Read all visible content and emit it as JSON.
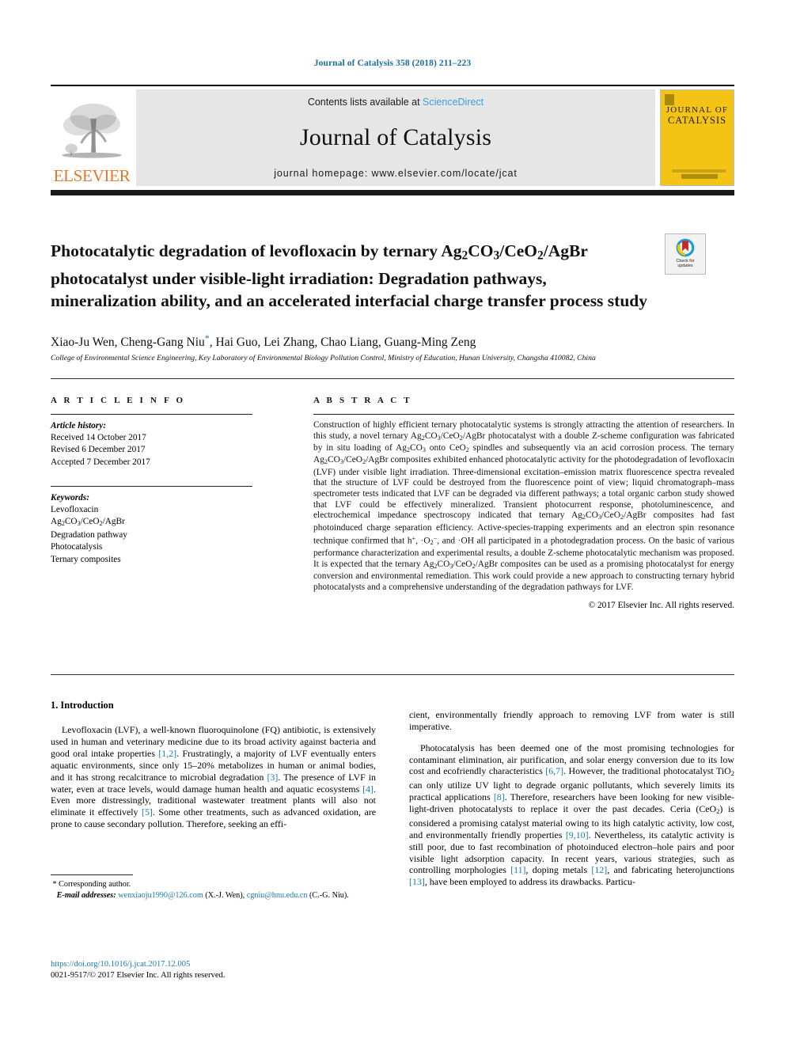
{
  "running_head": "Journal of Catalysis 358 (2018) 211–223",
  "masthead": {
    "publisher_logo_text": "ELSEVIER",
    "contents_line_prefix": "Contents lists available at ",
    "contents_line_link": "ScienceDirect",
    "journal_title": "Journal of Catalysis",
    "homepage_line": "journal homepage: www.elsevier.com/locate/jcat",
    "cover_line1": "JOURNAL OF",
    "cover_line2": "CATALYSIS"
  },
  "crossmark": {
    "line1": "Check for",
    "line2": "updates"
  },
  "article": {
    "title_part1": "Photocatalytic degradation of levofloxacin by ternary Ag",
    "title_sub1": "2",
    "title_part2": "CO",
    "title_sub2": "3",
    "title_part3": "/CeO",
    "title_sub3": "2",
    "title_part4": "/AgBr photocatalyst under visible-light irradiation: Degradation pathways, mineralization ability, and an accelerated interfacial charge transfer process study",
    "title_plain": "Photocatalytic degradation of levofloxacin by ternary Ag2CO3/CeO2/AgBr photocatalyst under visible-light irradiation: Degradation pathways, mineralization ability, and an accelerated interfacial charge transfer process study",
    "authors": "Xiao-Ju Wen, Cheng-Gang Niu",
    "authors_tail": ", Hai Guo, Lei Zhang, Chao Liang, Guang-Ming Zeng",
    "corresponding_marker": "*",
    "affiliation": "College of Environmental Science Engineering, Key Laboratory of Environmental Biology Pollution Control, Ministry of Education, Hunan University, Changsha 410082, China"
  },
  "info": {
    "heading": "A R T I C L E   I N F O",
    "history_label": "Article history:",
    "history": [
      "Received 14 October 2017",
      "Revised 6 December 2017",
      "Accepted 7 December 2017"
    ],
    "keywords_label": "Keywords:",
    "keywords": [
      "Levofloxacin",
      "Ag2CO3/CeO2/AgBr",
      "Degradation pathway",
      "Photocatalysis",
      "Ternary composites"
    ]
  },
  "abstract": {
    "heading": "A B S T R A C T",
    "text": "Construction of highly efficient ternary photocatalytic systems is strongly attracting the attention of researchers. In this study, a novel ternary Ag2CO3/CeO2/AgBr photocatalyst with a double Z-scheme configuration was fabricated by in situ loading of Ag2CO3 onto CeO2 spindles and subsequently via an acid corrosion process. The ternary Ag2CO3/CeO2/AgBr composites exhibited enhanced photocatalytic activity for the photodegradation of levofloxacin (LVF) under visible light irradiation. Three-dimensional excitation–emission matrix fluorescence spectra revealed that the structure of LVF could be destroyed from the fluorescence point of view; liquid chromatograph–mass spectrometer tests indicated that LVF can be degraded via different pathways; a total organic carbon study showed that LVF could be effectively mineralized. Transient photocurrent response, photoluminescence, and electrochemical impedance spectroscopy indicated that ternary Ag2CO3/CeO2/AgBr composites had fast photoinduced charge separation efficiency. Active-species-trapping experiments and an electron spin resonance technique confirmed that h+, ·O2−, and ·OH all participated in a photodegradation process. On the basic of various performance characterization and experimental results, a double Z-scheme photocatalytic mechanism was proposed. It is expected that the ternary Ag2CO3/CeO2/AgBr composites can be used as a promising photocatalyst for energy conversion and environmental remediation. This work could provide a new approach to constructing ternary hybrid photocatalysts and a comprehensive understanding of the degradation pathways for LVF.",
    "copyright": "© 2017 Elsevier Inc. All rights reserved."
  },
  "section": {
    "number_title": "1. Introduction",
    "left_paragraph": "Levofloxacin (LVF), a well-known fluoroquinolone (FQ) antibiotic, is extensively used in human and veterinary medicine due to its broad activity against bacteria and good oral intake properties [1,2]. Frustratingly, a majority of LVF eventually enters aquatic environments, since only 15–20% metabolizes in human or animal bodies, and it has strong recalcitrance to microbial degradation [3]. The presence of LVF in water, even at trace levels, would damage human health and aquatic ecosystems [4]. Even more distressingly, traditional wastewater treatment plants will also not eliminate it effectively [5]. Some other treatments, such as advanced oxidation, are prone to cause secondary pollution. Therefore, seeking an effi-",
    "right_paragraph_1": "cient, environmentally friendly approach to removing LVF from water is still imperative.",
    "right_paragraph_2": "Photocatalysis has been deemed one of the most promising technologies for contaminant elimination, air purification, and solar energy conversion due to its low cost and ecofriendly characteristics [6,7]. However, the traditional photocatalyst TiO2 can only utilize UV light to degrade organic pollutants, which severely limits its practical applications [8]. Therefore, researchers have been looking for new visible-light-driven photocatalysts to replace it over the past decades. Ceria (CeO2) is considered a promising catalyst material owing to its high catalytic activity, low cost, and environmentally friendly properties [9,10]. Nevertheless, its catalytic activity is still poor, due to fast recombination of photoinduced electron–hole pairs and poor visible light adsorption capacity. In recent years, various strategies, such as controlling morphologies [11], doping metals [12], and fabricating heterojunctions [13], have been employed to address its drawbacks. Particu-"
  },
  "footnote": {
    "corresponding": "Corresponding author.",
    "email_label": "E-mail addresses:",
    "email1": "wenxiaoju1990@126.com",
    "email1_owner": "(X.-J. Wen),",
    "email2": "cgniu@hnu.edu.cn",
    "email2_owner": "(C.-G. Niu)."
  },
  "footer": {
    "doi": "https://doi.org/10.1016/j.jcat.2017.12.005",
    "issn_line": "0021-9517/© 2017 Elsevier Inc. All rights reserved."
  },
  "colors": {
    "link": "#1a7aae",
    "running_head": "#1a6fa3",
    "elsevier_orange": "#E87722",
    "cover_yellow": "#f3c316",
    "masthead_gray": "#e6e6e6"
  }
}
